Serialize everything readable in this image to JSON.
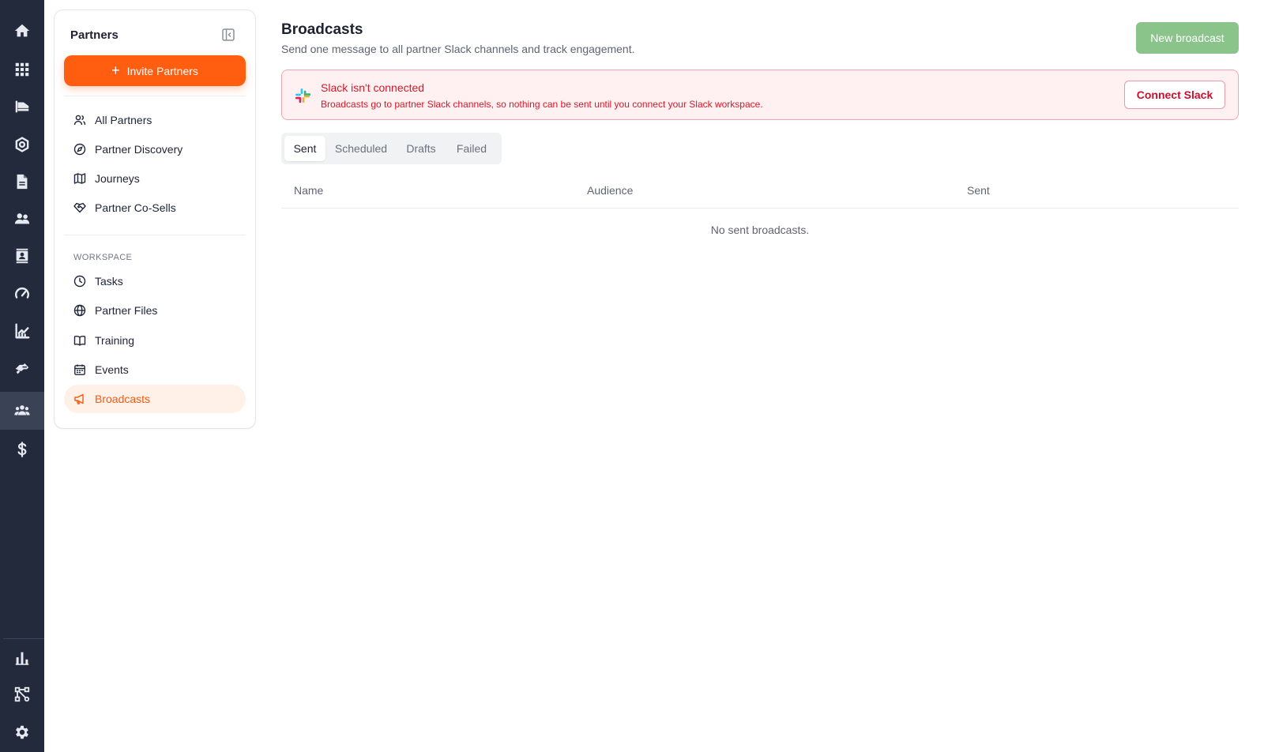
{
  "rail": {
    "top_icons": [
      "home-icon",
      "apps-grid-icon",
      "flag-icon",
      "cog-icon",
      "document-icon",
      "users-icon",
      "contact-card-icon",
      "gauge-icon",
      "analytics-icon",
      "handshake-icon",
      "partners-icon",
      "dollar-icon"
    ],
    "bottom_icons": [
      "bar-chart-icon",
      "workflow-icon",
      "settings-icon"
    ],
    "active": "partners-icon"
  },
  "panel": {
    "title": "Partners",
    "invite_label": "Invite Partners",
    "primary_items": [
      {
        "label": "All Partners",
        "icon": "users-icon"
      },
      {
        "label": "Partner Discovery",
        "icon": "compass-icon"
      },
      {
        "label": "Journeys",
        "icon": "map-icon"
      },
      {
        "label": "Partner Co-Sells",
        "icon": "handshake-icon"
      }
    ],
    "workspace_label": "WORKSPACE",
    "workspace_items": [
      {
        "label": "Tasks",
        "icon": "clock-icon"
      },
      {
        "label": "Partner Files",
        "icon": "globe-icon"
      },
      {
        "label": "Training",
        "icon": "book-open-icon"
      },
      {
        "label": "Events",
        "icon": "calendar-icon"
      },
      {
        "label": "Broadcasts",
        "icon": "megaphone-icon",
        "active": true
      }
    ]
  },
  "main": {
    "title": "Broadcasts",
    "subtitle": "Send one message to all partner Slack channels and track engagement.",
    "new_broadcast_label": "New broadcast",
    "alert": {
      "title": "Slack isn't connected",
      "text": "Broadcasts go to partner Slack channels, so nothing can be sent until you connect your Slack workspace.",
      "button": "Connect Slack",
      "icon": "slack-logo-icon"
    },
    "tabs": [
      {
        "label": "Sent",
        "active": true
      },
      {
        "label": "Scheduled"
      },
      {
        "label": "Drafts"
      },
      {
        "label": "Failed"
      }
    ],
    "table": {
      "columns": [
        "Name",
        "Audience",
        "Sent"
      ],
      "empty_text": "No sent broadcasts."
    }
  },
  "colors": {
    "rail_bg": "#232a3b",
    "accent": "#ff5d0f",
    "alert_red": "#d11a2a",
    "new_broadcast_bg": "#8bc48a"
  }
}
